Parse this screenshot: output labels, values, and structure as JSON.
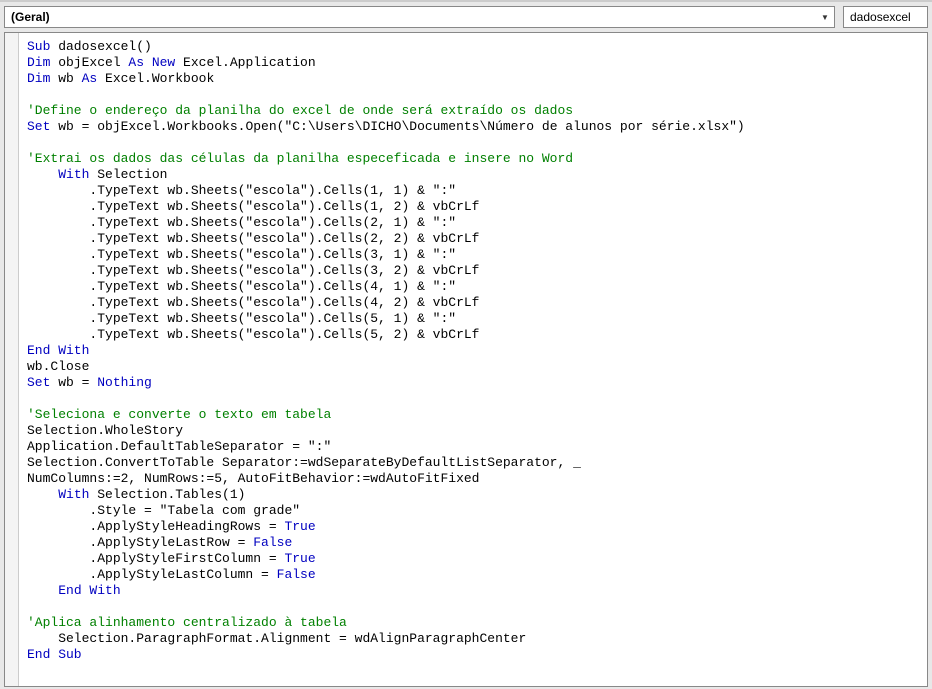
{
  "topbar": {
    "scope": "(Geral)",
    "proc": "dadosexcel"
  },
  "code": {
    "l1_kw": "Sub",
    "l1_txt": " dadosexcel()",
    "l2_kw1": "Dim",
    "l2_txt1": " objExcel ",
    "l2_kw2": "As New",
    "l2_txt2": " Excel.Application",
    "l3_kw1": "Dim",
    "l3_txt1": " wb ",
    "l3_kw2": "As",
    "l3_txt2": " Excel.Workbook",
    "l5_cm": "'Define o endereço da planilha do excel de onde será extraído os dados",
    "l6_kw": "Set",
    "l6_txt": " wb = objExcel.Workbooks.Open(\"C:\\Users\\DICHO\\Documents\\Número de alunos por série.xlsx\")",
    "l8_cm": "'Extrai os dados das células da planilha especeficada e insere no Word",
    "l9_kw": "With",
    "l9_txt": " Selection",
    "l10": "        .TypeText wb.Sheets(\"escola\").Cells(1, 1) & \":\"",
    "l11": "        .TypeText wb.Sheets(\"escola\").Cells(1, 2) & vbCrLf",
    "l12": "        .TypeText wb.Sheets(\"escola\").Cells(2, 1) & \":\"",
    "l13": "        .TypeText wb.Sheets(\"escola\").Cells(2, 2) & vbCrLf",
    "l14": "        .TypeText wb.Sheets(\"escola\").Cells(3, 1) & \":\"",
    "l15": "        .TypeText wb.Sheets(\"escola\").Cells(3, 2) & vbCrLf",
    "l16": "        .TypeText wb.Sheets(\"escola\").Cells(4, 1) & \":\"",
    "l17": "        .TypeText wb.Sheets(\"escola\").Cells(4, 2) & vbCrLf",
    "l18": "        .TypeText wb.Sheets(\"escola\").Cells(5, 1) & \":\"",
    "l19": "        .TypeText wb.Sheets(\"escola\").Cells(5, 2) & vbCrLf",
    "l20_kw": "End With",
    "l21": "wb.Close",
    "l22_kw1": "Set",
    "l22_txt": " wb = ",
    "l22_kw2": "Nothing",
    "l24_cm": "'Seleciona e converte o texto em tabela",
    "l25": "Selection.WholeStory",
    "l26": "Application.DefaultTableSeparator = \":\"",
    "l27": "Selection.ConvertToTable Separator:=wdSeparateByDefaultListSeparator, _",
    "l28": "NumColumns:=2, NumRows:=5, AutoFitBehavior:=wdAutoFitFixed",
    "l29_kw": "With",
    "l29_txt": " Selection.Tables(1)",
    "l30": "        .Style = \"Tabela com grade\"",
    "l31_txt": "        .ApplyStyleHeadingRows = ",
    "l31_kw": "True",
    "l32_txt": "        .ApplyStyleLastRow = ",
    "l32_kw": "False",
    "l33_txt": "        .ApplyStyleFirstColumn = ",
    "l33_kw": "True",
    "l34_txt": "        .ApplyStyleLastColumn = ",
    "l34_kw": "False",
    "l35_kw": "End With",
    "l37_cm": "'Aplica alinhamento centralizado à tabela",
    "l38": "    Selection.ParagraphFormat.Alignment = wdAlignParagraphCenter",
    "l39_kw": "End Sub"
  }
}
